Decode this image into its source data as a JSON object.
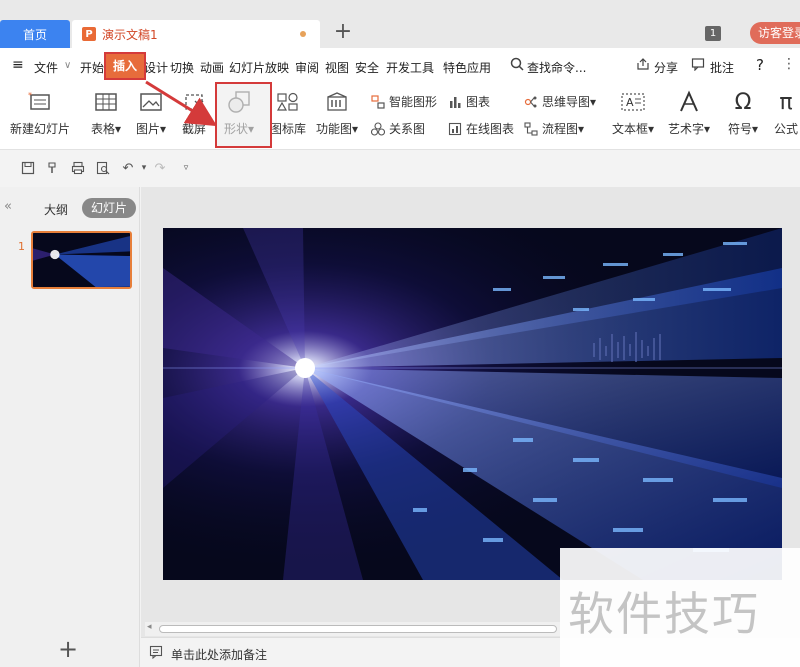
{
  "tabs": {
    "home_label": "首页",
    "doc_title": "演示文稿1",
    "doc_icon": "P",
    "new_tab": "+",
    "window_count": "1",
    "visitor_login": "访客登录"
  },
  "menu": {
    "file": "文件",
    "items": [
      "开始",
      "插入",
      "设计",
      "切换",
      "动画",
      "幻灯片放映",
      "审阅",
      "视图",
      "安全",
      "开发工具",
      "特色应用"
    ],
    "search": "查找命令...",
    "share": "分享",
    "comment": "批注",
    "help": "?"
  },
  "ribbon": {
    "new_slide": "新建幻灯片",
    "table": "表格",
    "picture": "图片",
    "screenshot": "截屏",
    "shape": "形状",
    "icon_lib": "图标库",
    "func_chart": "功能图",
    "smart_art": "智能图形",
    "chart": "图表",
    "relation": "关系图",
    "online_chart": "在线图表",
    "mindmap": "思维导图",
    "flowchart": "流程图",
    "textbox": "文本框",
    "wordart": "艺术字",
    "symbol": "符号",
    "formula": "公式"
  },
  "left_panel": {
    "outline": "大纲",
    "slides": "幻灯片",
    "slide_number": "1",
    "add": "+"
  },
  "notes": {
    "placeholder": "单击此处添加备注"
  },
  "watermark": "软件技巧",
  "colors": {
    "accent": "#e76c3b",
    "home_tab": "#3c83f0",
    "highlight": "#d43a3a"
  }
}
